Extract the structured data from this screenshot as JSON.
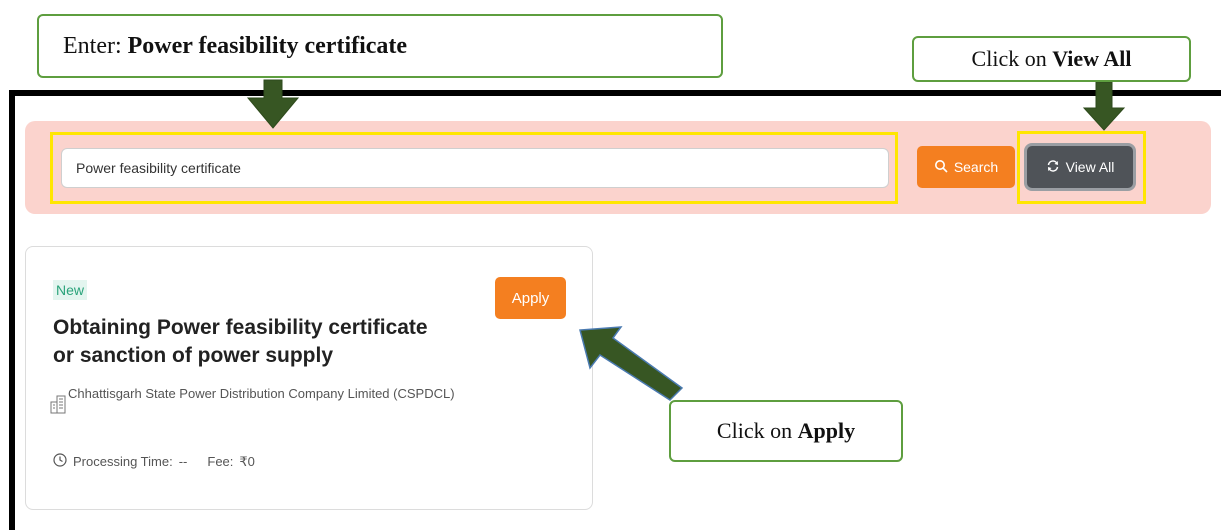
{
  "callouts": {
    "enter": {
      "prefix": "Enter: ",
      "emphasis": "Power feasibility certificate"
    },
    "view_all": {
      "prefix": "Click on ",
      "emphasis": "View All"
    },
    "apply": {
      "prefix": "Click on ",
      "emphasis": "Apply"
    }
  },
  "search": {
    "value": "Power feasibility certificate",
    "search_label": "Search",
    "view_all_label": "View All"
  },
  "service_card": {
    "badge": "New",
    "title": "Obtaining Power feasibility certificate or sanction of power supply",
    "apply_label": "Apply",
    "department": "Chhattisgarh State Power Distribution Company Limited (CSPDCL)",
    "processing_label": "Processing Time:",
    "processing_value": "--",
    "fee_label": "Fee:",
    "fee_value": "₹0"
  },
  "colors": {
    "accent_orange": "#f47f20",
    "dark_button": "#4f5358",
    "search_band": "#fbd3cd",
    "highlight_yellow": "#ffe600",
    "callout_border": "#5e9e3f",
    "arrow_green": "#375623",
    "badge_green": "#2aa37a"
  },
  "icons": {
    "search": "magnifier-icon",
    "view_all": "refresh-icon",
    "department": "building-icon",
    "processing": "clock-icon"
  }
}
